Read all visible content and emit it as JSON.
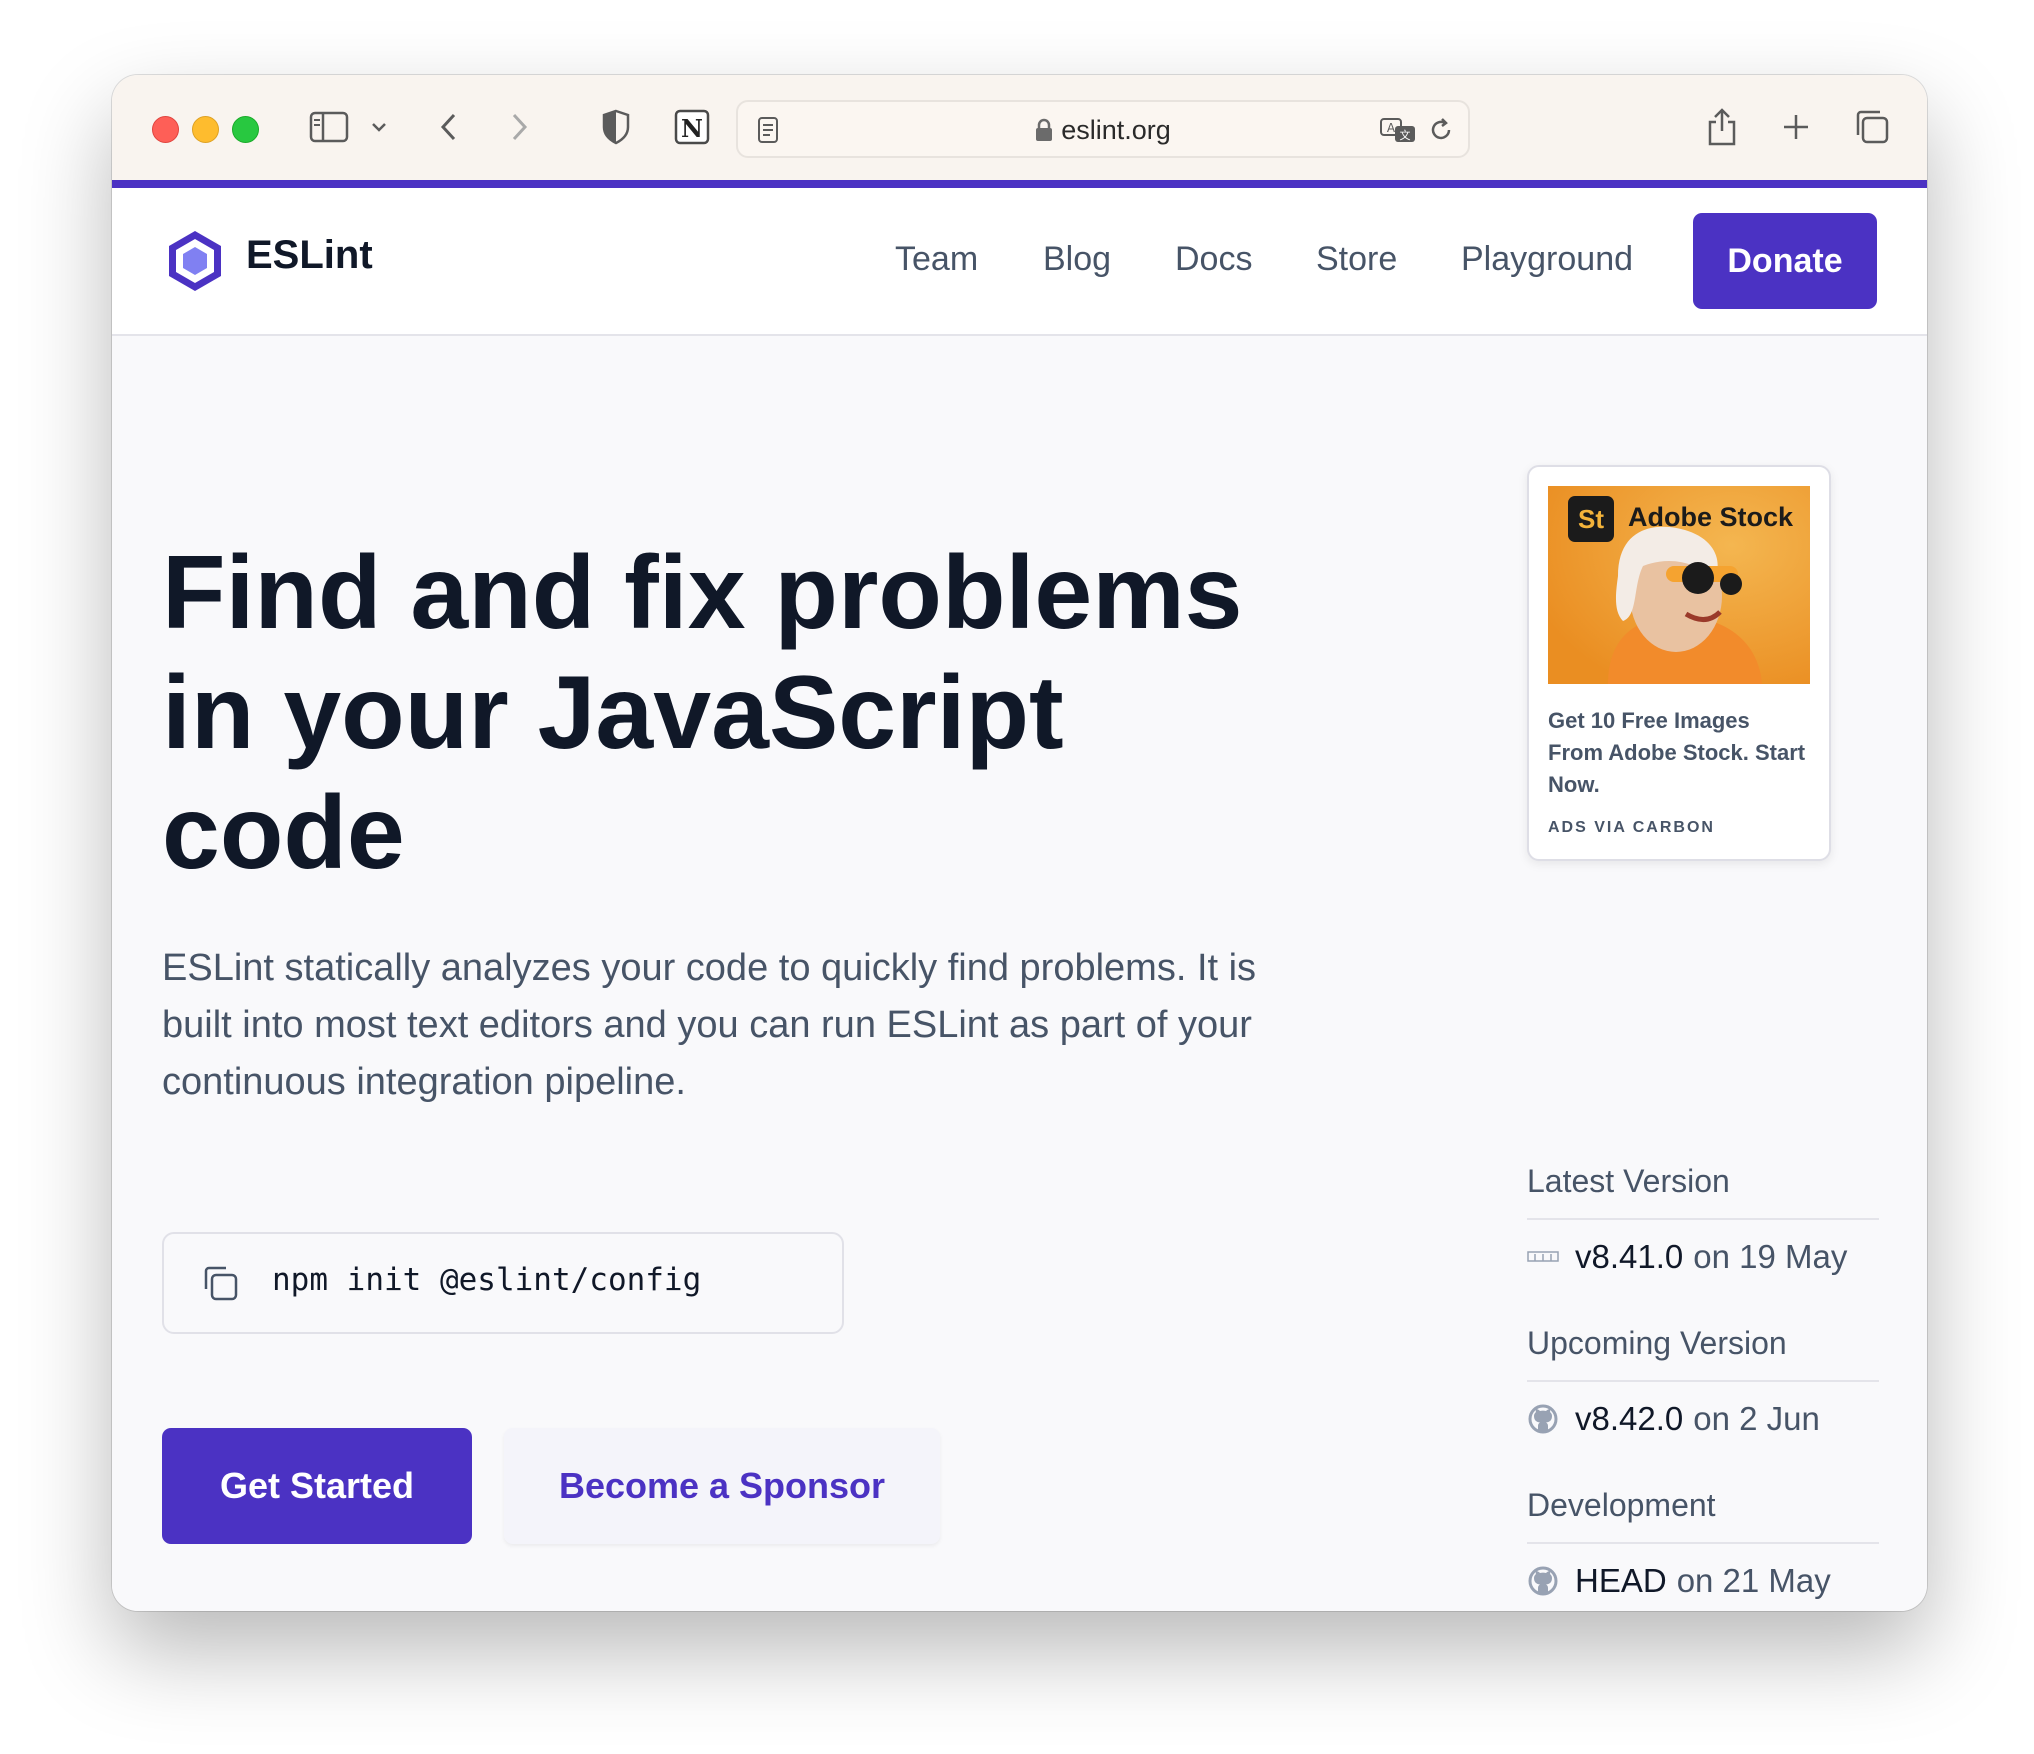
{
  "browser": {
    "url": "eslint.org"
  },
  "site": {
    "brand": "ESLint",
    "nav": [
      "Team",
      "Blog",
      "Docs",
      "Store",
      "Playground"
    ],
    "donate": "Donate",
    "hero": {
      "title": "Find and fix problems in your JavaScript code",
      "description": "ESLint statically analyzes your code to quickly find problems. It is built into most text editors and you can run ESLint as part of your continuous integration pipeline.",
      "command": "npm init @eslint/config",
      "primary_button": "Get Started",
      "secondary_button": "Become a Sponsor"
    },
    "ad": {
      "brand": "Adobe Stock",
      "badge": "St",
      "text": "Get 10 Free Images From Adobe Stock. Start Now.",
      "via": "ADS VIA CARBON"
    },
    "versions": [
      {
        "label": "Latest Version",
        "version": "v8.41.0",
        "date": "on 19 May",
        "icon": "npm-icon"
      },
      {
        "label": "Upcoming Version",
        "version": "v8.42.0",
        "date": "on 2 Jun",
        "icon": "github-icon"
      },
      {
        "label": "Development",
        "version": "HEAD",
        "date": "on 21 May",
        "icon": "github-icon"
      }
    ]
  },
  "colors": {
    "accent": "#4b32c3",
    "heading": "#101828",
    "body": "#475467"
  }
}
